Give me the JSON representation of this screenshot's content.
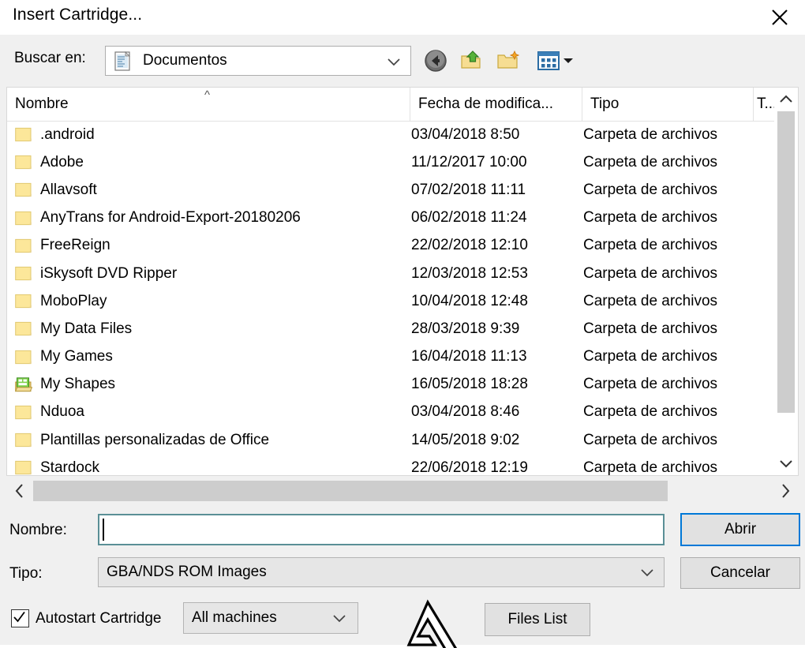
{
  "window": {
    "title": "Insert Cartridge...",
    "close_icon": "close-icon"
  },
  "lookin": {
    "label": "Buscar en:",
    "value": "Documentos",
    "icon": "document-icon",
    "chevron_icon": "chevron-down-icon"
  },
  "toolbar": {
    "back_icon": "back-arrow-icon",
    "up_icon": "up-one-level-folder-icon",
    "new_folder_icon": "new-folder-icon",
    "views_icon": "views-grid-icon",
    "views_chevron_icon": "chevron-down-icon"
  },
  "columns": {
    "name": "Nombre",
    "date": "Fecha de modifica...",
    "type": "Tipo",
    "size": "T...",
    "sort_caret": "^"
  },
  "files": [
    {
      "name": ".android",
      "date": "03/04/2018 8:50",
      "type": "Carpeta de archivos",
      "icon": "folder-icon"
    },
    {
      "name": "Adobe",
      "date": "11/12/2017 10:00",
      "type": "Carpeta de archivos",
      "icon": "folder-icon"
    },
    {
      "name": "Allavsoft",
      "date": "07/02/2018 11:11",
      "type": "Carpeta de archivos",
      "icon": "folder-icon"
    },
    {
      "name": "AnyTrans for Android-Export-20180206",
      "date": "06/02/2018 11:24",
      "type": "Carpeta de archivos",
      "icon": "folder-icon"
    },
    {
      "name": "FreeReign",
      "date": "22/02/2018 12:10",
      "type": "Carpeta de archivos",
      "icon": "folder-icon"
    },
    {
      "name": "iSkysoft DVD Ripper",
      "date": "12/03/2018 12:53",
      "type": "Carpeta de archivos",
      "icon": "folder-icon"
    },
    {
      "name": "MoboPlay",
      "date": "10/04/2018 12:48",
      "type": "Carpeta de archivos",
      "icon": "folder-icon"
    },
    {
      "name": "My Data Files",
      "date": "28/03/2018 9:39",
      "type": "Carpeta de archivos",
      "icon": "folder-icon"
    },
    {
      "name": "My Games",
      "date": "16/04/2018 11:13",
      "type": "Carpeta de archivos",
      "icon": "folder-icon"
    },
    {
      "name": "My Shapes",
      "date": "16/05/2018 18:28",
      "type": "Carpeta de archivos",
      "icon": "visio-shapes-folder-icon"
    },
    {
      "name": "Nduoa",
      "date": "03/04/2018 8:46",
      "type": "Carpeta de archivos",
      "icon": "folder-icon"
    },
    {
      "name": "Plantillas personalizadas de Office",
      "date": "14/05/2018 9:02",
      "type": "Carpeta de archivos",
      "icon": "folder-icon"
    },
    {
      "name": "Stardock",
      "date": "22/06/2018 12:19",
      "type": "Carpeta de archivos",
      "icon": "folder-icon"
    }
  ],
  "scrollbars": {
    "up_icon": "chevron-up-icon",
    "down_icon": "chevron-down-icon",
    "left_icon": "chevron-left-icon",
    "right_icon": "chevron-right-icon"
  },
  "form": {
    "name_label": "Nombre:",
    "name_value": "",
    "name_placeholder": "",
    "type_label": "Tipo:",
    "type_value": "GBA/NDS ROM Images",
    "type_chevron_icon": "chevron-down-icon"
  },
  "buttons": {
    "open": "Abrir",
    "cancel": "Cancelar",
    "files_list": "Files List"
  },
  "options": {
    "autostart_label": "Autostart Cartridge",
    "autostart_checked": true,
    "check_icon": "checkmark-icon",
    "machine_value": "All machines",
    "machine_chevron_icon": "chevron-down-icon",
    "logo_icon": "triangle-logo-icon"
  },
  "colors": {
    "accent": "#0078d7",
    "dialog_bg": "#f0f0f0",
    "list_bg": "#ffffff",
    "folder": "#fce79a",
    "scroll_thumb": "#cdcdcd",
    "input_focus_border": "#5a8f96"
  }
}
